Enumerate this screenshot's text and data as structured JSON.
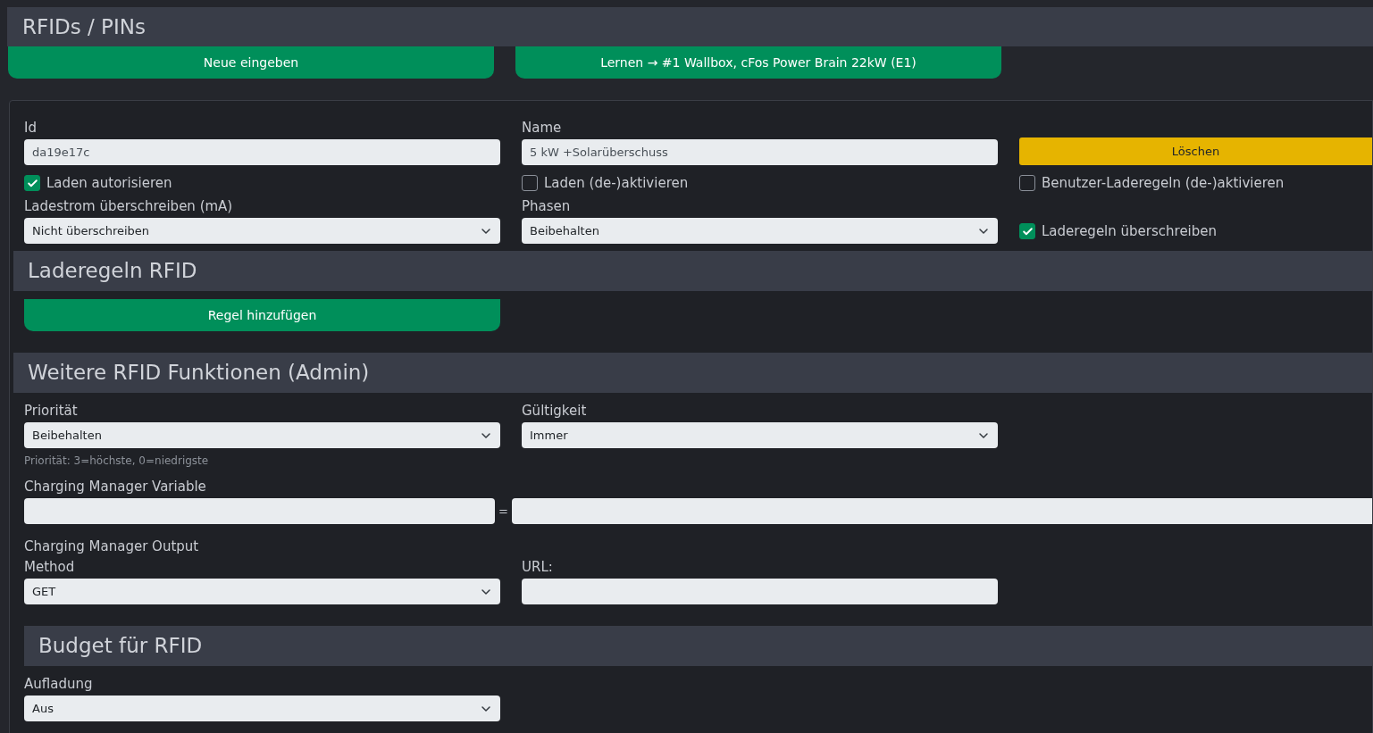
{
  "page_title": "RFIDs / PINs",
  "top_buttons": [
    "Neue eingeben",
    "Lernen → #1 Wallbox, cFos Power Brain 22kW (E1)"
  ],
  "id_field": {
    "label": "Id",
    "value": "da19e17c"
  },
  "name_field": {
    "label": "Name",
    "value": "5 kW +Solarüberschuss"
  },
  "delete_button": "Löschen",
  "checkboxes": [
    {
      "label": "Laden autorisieren",
      "checked": true
    },
    {
      "label": "Laden (de-)aktivieren",
      "checked": false
    },
    {
      "label": "Benutzer-Laderegeln (de-)aktivieren",
      "checked": false
    }
  ],
  "current_select": {
    "label": "Ladestrom überschreiben (mA)",
    "value": "Nicht überschreiben"
  },
  "phases_select": {
    "label": "Phasen",
    "value": "Beibehalten"
  },
  "override_rules": {
    "label": "Laderegeln überschreiben",
    "checked": true
  },
  "rules_section": {
    "title": "Laderegeln RFID",
    "add_button": "Regel hinzufügen"
  },
  "admin_section": {
    "title": "Weitere RFID Funktionen (Admin)",
    "priority": {
      "label": "Priorität",
      "value": "Beibehalten",
      "hint": "Priorität: 3=höchste, 0=niedrigste"
    },
    "validity": {
      "label": "Gültigkeit",
      "value": "Immer"
    },
    "variable": {
      "label": "Charging Manager Variable",
      "equals": "="
    },
    "output": {
      "title": "Charging Manager Output",
      "method": {
        "label": "Method",
        "value": "GET"
      },
      "url": {
        "label": "URL:"
      }
    }
  },
  "budget_section": {
    "title": "Budget für RFID",
    "charging": {
      "label": "Aufladung",
      "value": "Aus"
    }
  }
}
